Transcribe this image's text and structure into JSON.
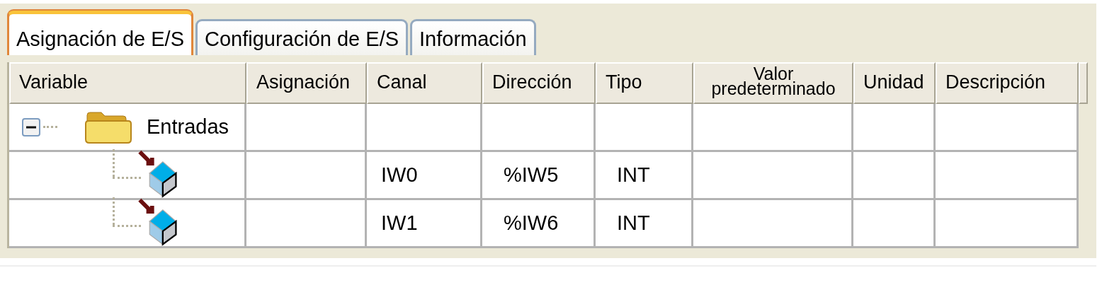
{
  "tabs": [
    {
      "label": "Asignación de E/S",
      "selected": true
    },
    {
      "label": "Configuración de E/S",
      "selected": false
    },
    {
      "label": "Información",
      "selected": false
    }
  ],
  "table": {
    "columns": [
      "Variable",
      "Asignación",
      "Canal",
      "Dirección",
      "Tipo",
      "Valor predeterminado",
      "Unidad",
      "Descripción"
    ],
    "rows": [
      {
        "kind": "group",
        "label": "Entradas",
        "expanded": true,
        "children": [
          {
            "kind": "input",
            "channel": "IW0",
            "address": "%IW5",
            "type": "INT"
          },
          {
            "kind": "input",
            "channel": "IW1",
            "address": "%IW6",
            "type": "INT"
          }
        ]
      }
    ]
  }
}
